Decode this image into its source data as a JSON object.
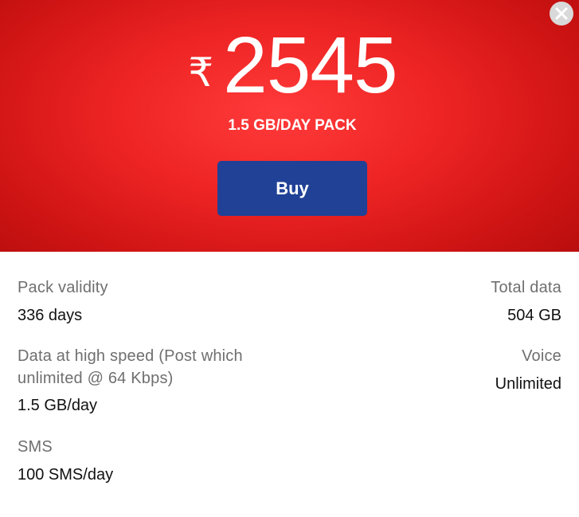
{
  "plan": {
    "currency_symbol": "₹",
    "price": "2545",
    "pack_name": "1.5 GB/DAY PACK",
    "buy_label": "Buy"
  },
  "details": {
    "validity": {
      "label": "Pack validity",
      "value": "336 days"
    },
    "total_data": {
      "label": "Total data",
      "value": "504 GB"
    },
    "high_speed": {
      "label_line1": "Data at high speed (Post which",
      "label_line2": "unlimited @ 64 Kbps)",
      "value": "1.5 GB/day"
    },
    "voice": {
      "label": "Voice",
      "value": "Unlimited"
    },
    "sms": {
      "label": "SMS",
      "value": "100 SMS/day"
    }
  },
  "icons": {
    "close": "close-icon"
  },
  "colors": {
    "hero_red": "#e82020",
    "buy_blue": "#204196",
    "label_gray": "#6f6f6f",
    "value_black": "#111111"
  }
}
